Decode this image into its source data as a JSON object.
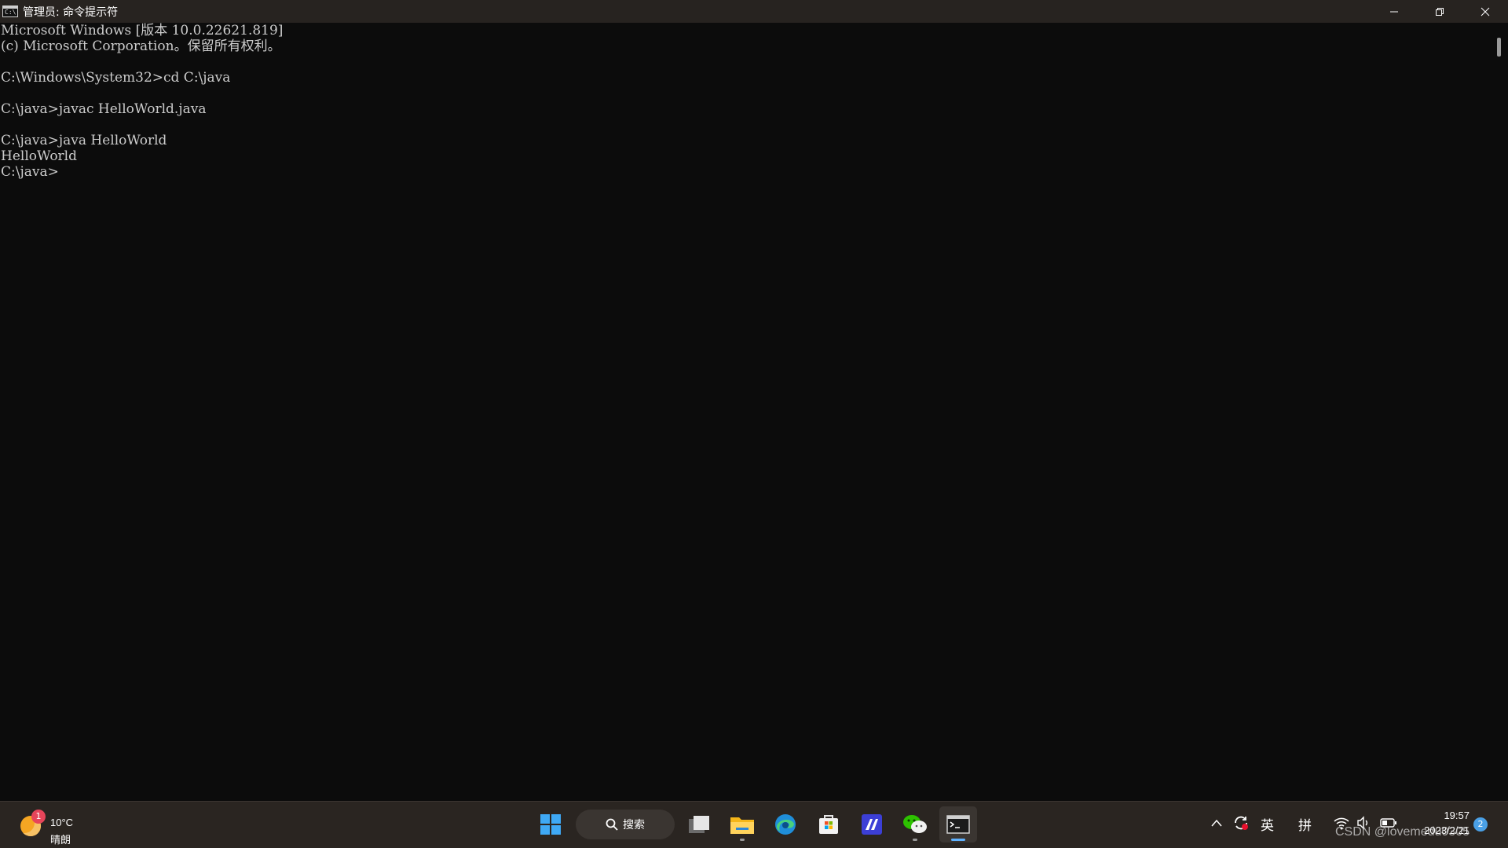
{
  "window": {
    "title": "管理员: 命令提示符",
    "icon_text": "C:\\",
    "controls": {
      "minimize": "—",
      "restore": "❐",
      "close": "✕"
    }
  },
  "console": {
    "lines": [
      "Microsoft Windows [版本 10.0.22621.819]",
      "(c) Microsoft Corporation。保留所有权利。",
      "",
      "C:\\Windows\\System32>cd C:\\java",
      "",
      "C:\\java>javac HelloWorld.java",
      "",
      "C:\\java>java HelloWorld",
      "HelloWorld",
      "C:\\java>"
    ]
  },
  "taskbar": {
    "weather": {
      "badge": "1",
      "temperature": "10°C",
      "condition": "晴朗"
    },
    "search_label": "搜索",
    "apps": [
      {
        "name": "windows-start-icon"
      },
      {
        "name": "task-view-icon"
      },
      {
        "name": "file-explorer-icon"
      },
      {
        "name": "edge-icon"
      },
      {
        "name": "microsoft-store-icon"
      },
      {
        "name": "app-icon"
      },
      {
        "name": "wechat-icon"
      },
      {
        "name": "terminal-icon"
      }
    ],
    "tray": {
      "chevron": "^",
      "ime_lang": "英",
      "ime_mode": "拼",
      "time": "19:57",
      "date": "2023/2/21",
      "notification_count": "2"
    },
    "watermark": "CSDN @lovemedu0305"
  },
  "colors": {
    "console_bg": "#0c0c0c",
    "console_text": "#cccccc",
    "taskbar_bg": "#2a2521",
    "accent": "#5fb2ff"
  }
}
